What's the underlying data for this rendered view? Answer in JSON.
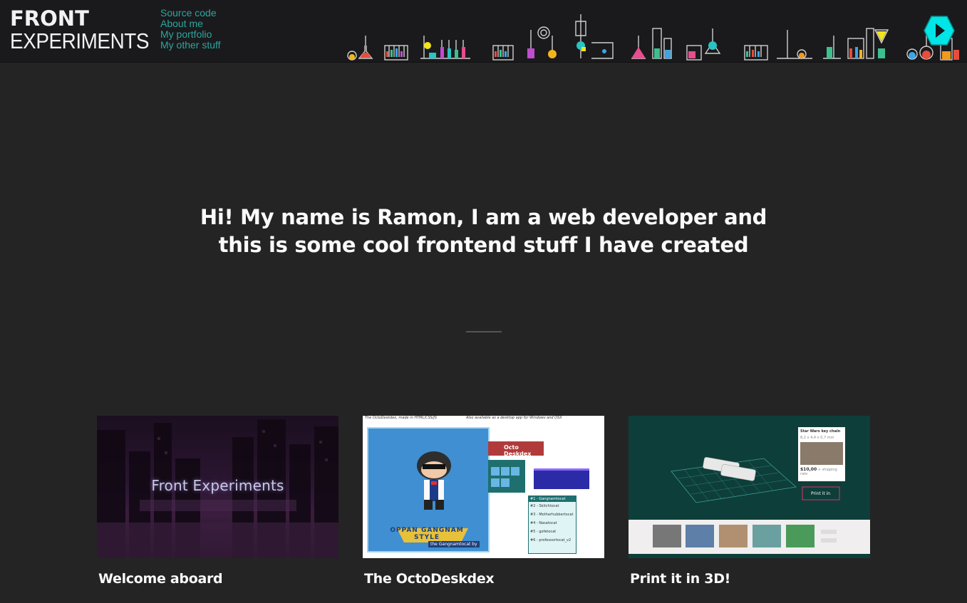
{
  "header": {
    "logo": {
      "line1": "FRONT",
      "line2": "EXPERIMENTS"
    },
    "nav": [
      {
        "label": "Source code"
      },
      {
        "label": "About me"
      },
      {
        "label": "My portfolio"
      },
      {
        "label": "My other stuff"
      }
    ],
    "play_icon": "play-icon"
  },
  "hero": {
    "line1": "Hi! My name is Ramon, I am a web developer and",
    "line2": "this is some cool frontend stuff I have created"
  },
  "cards": [
    {
      "title": "Welcome aboard",
      "thumb_text": "Front Experiments"
    },
    {
      "title": "The OctoDeskdex",
      "thumb_caption": "The OctoDeskdex, made in HTML/CSS/JS",
      "thumb_note": "Also available as a desktop app for Windows and OSX",
      "app_name": "Octo Deskdex",
      "list": [
        "#1 - Gangnamtocat",
        "#2 - Skitchtocat",
        "#3 - Motherhubbertocat",
        "#4 - Nasatocat",
        "#5 - gofetocat",
        "#6 - professortocat_v2"
      ],
      "art_text": "OPPAN GANGNAM STYLE",
      "footer": "the Gangnamtocat by"
    },
    {
      "title": "Print it in 3D!",
      "panel_title": "Star Wars key chain",
      "panel_size": "8,2 x 4,4 x 0,7 mm",
      "price": "$10,00",
      "price_note": "+ shipping rate",
      "button": "Print it in"
    }
  ],
  "colors": {
    "accent": "#2ba6a0",
    "background": "#242424",
    "header_bg": "#1a1a1c",
    "play": "#00e5e5"
  }
}
